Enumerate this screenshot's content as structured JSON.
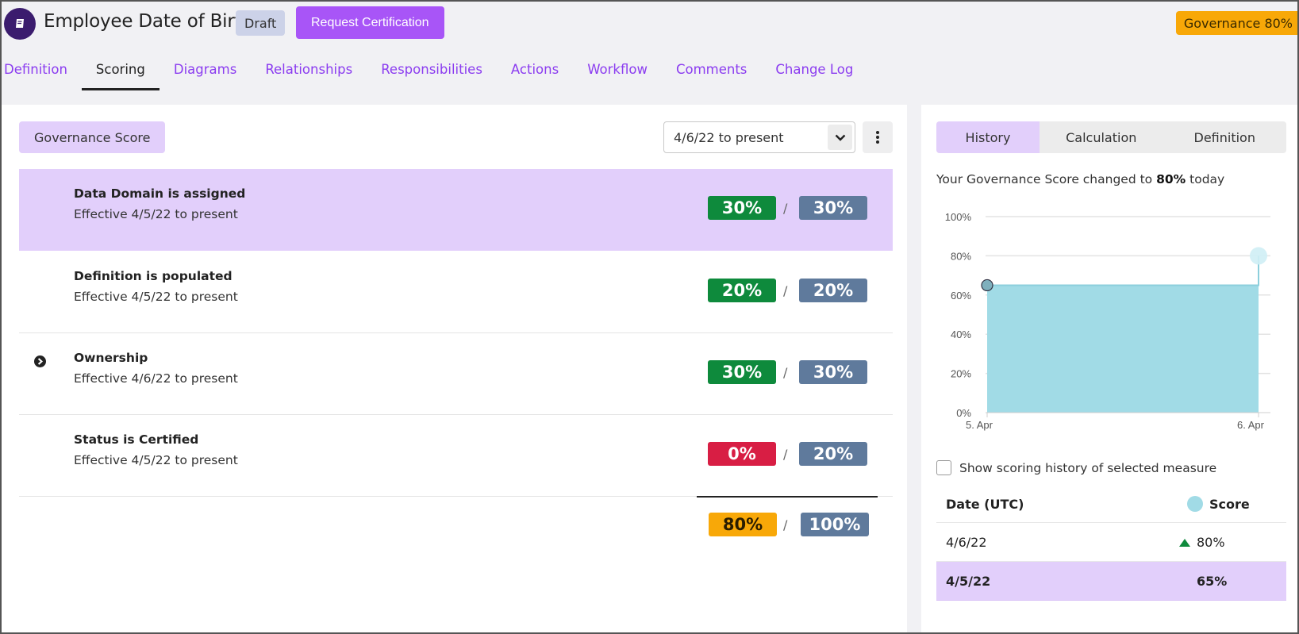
{
  "header": {
    "title": "Employee Date of Birth",
    "status_badge": "Draft",
    "request_button": "Request Certification",
    "governance_badge": "Governance 80%"
  },
  "tabs": [
    {
      "label": "Definition",
      "active": false
    },
    {
      "label": "Scoring",
      "active": true
    },
    {
      "label": "Diagrams",
      "active": false
    },
    {
      "label": "Relationships",
      "active": false
    },
    {
      "label": "Responsibilities",
      "active": false
    },
    {
      "label": "Actions",
      "active": false
    },
    {
      "label": "Workflow",
      "active": false
    },
    {
      "label": "Comments",
      "active": false
    },
    {
      "label": "Change Log",
      "active": false
    }
  ],
  "scoring": {
    "chip_label": "Governance Score",
    "date_range": "4/6/22 to present",
    "measures": [
      {
        "title": "Data Domain is assigned",
        "effective": "Effective 4/5/22 to present",
        "score": "30%",
        "max": "30%",
        "score_color": "green",
        "selected": true,
        "expandable": false
      },
      {
        "title": "Definition is populated",
        "effective": "Effective 4/5/22 to present",
        "score": "20%",
        "max": "20%",
        "score_color": "green",
        "selected": false,
        "expandable": false
      },
      {
        "title": "Ownership",
        "effective": "Effective 4/6/22 to present",
        "score": "30%",
        "max": "30%",
        "score_color": "green",
        "selected": false,
        "expandable": true
      },
      {
        "title": "Status is Certified",
        "effective": "Effective 4/5/22 to present",
        "score": "0%",
        "max": "20%",
        "score_color": "red",
        "selected": false,
        "expandable": false
      }
    ],
    "total": {
      "score": "80%",
      "max": "100%"
    },
    "separator": "/"
  },
  "history_panel": {
    "tabs": [
      {
        "label": "History",
        "active": true
      },
      {
        "label": "Calculation",
        "active": false
      },
      {
        "label": "Definition",
        "active": false
      }
    ],
    "changed_prefix": "Your Governance Score changed to ",
    "changed_value": "80%",
    "changed_suffix": " today",
    "show_history_label": "Show scoring history of selected measure",
    "show_history_checked": false,
    "table": {
      "headers": [
        "Date (UTC)",
        "Score"
      ],
      "rows": [
        {
          "date": "4/6/22",
          "score": "80%",
          "trend": "up",
          "selected": false
        },
        {
          "date": "4/5/22",
          "score": "65%",
          "trend": "",
          "selected": true
        }
      ]
    }
  },
  "chart_data": {
    "type": "area",
    "x": [
      "5. Apr",
      "6. Apr"
    ],
    "series": [
      {
        "values": [
          65,
          80
        ]
      }
    ],
    "y_ticks": [
      "0%",
      "20%",
      "40%",
      "60%",
      "80%",
      "100%"
    ],
    "ylim": [
      0,
      100
    ],
    "step": true,
    "grid": true,
    "colors": {
      "fill": "#a1dbe6",
      "line": "#8ccfdc",
      "marker": "#7fb0bd",
      "highlight": "#cfeef5"
    }
  },
  "colors": {
    "accent": "#a855f7",
    "tab_link": "#8b3cf0",
    "selected_bg": "#e2cffb",
    "green": "#0e8a3c",
    "red": "#d81e44",
    "slate": "#5f7a9c",
    "orange": "#f8a808"
  }
}
